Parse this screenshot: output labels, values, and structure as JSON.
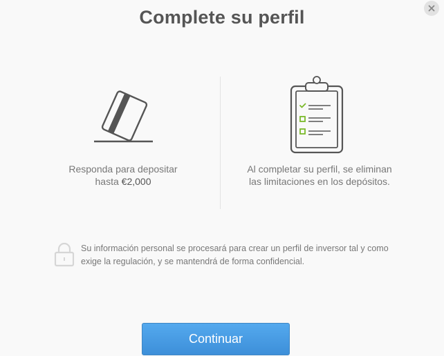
{
  "modal": {
    "title": "Complete su perfil",
    "close_icon": "close-icon",
    "left_column": {
      "icon": "credit-card-icon",
      "text_line1": "Responda para depositar",
      "text_prefix": "hasta ",
      "amount": "€2,000"
    },
    "right_column": {
      "icon": "clipboard-checklist-icon",
      "text": "Al completar su perfil, se eliminan las limitaciones en los depósitos."
    },
    "privacy": {
      "icon": "lock-icon",
      "text": "Su información personal se procesará para crear un perfil de inversor tal y como exige la regulación, y se mantendrá de forma confidencial."
    },
    "continue_label": "Continuar",
    "colors": {
      "accent_button": "#4a9de4",
      "check_green": "#7ab929",
      "icon_gray": "#555555"
    }
  }
}
